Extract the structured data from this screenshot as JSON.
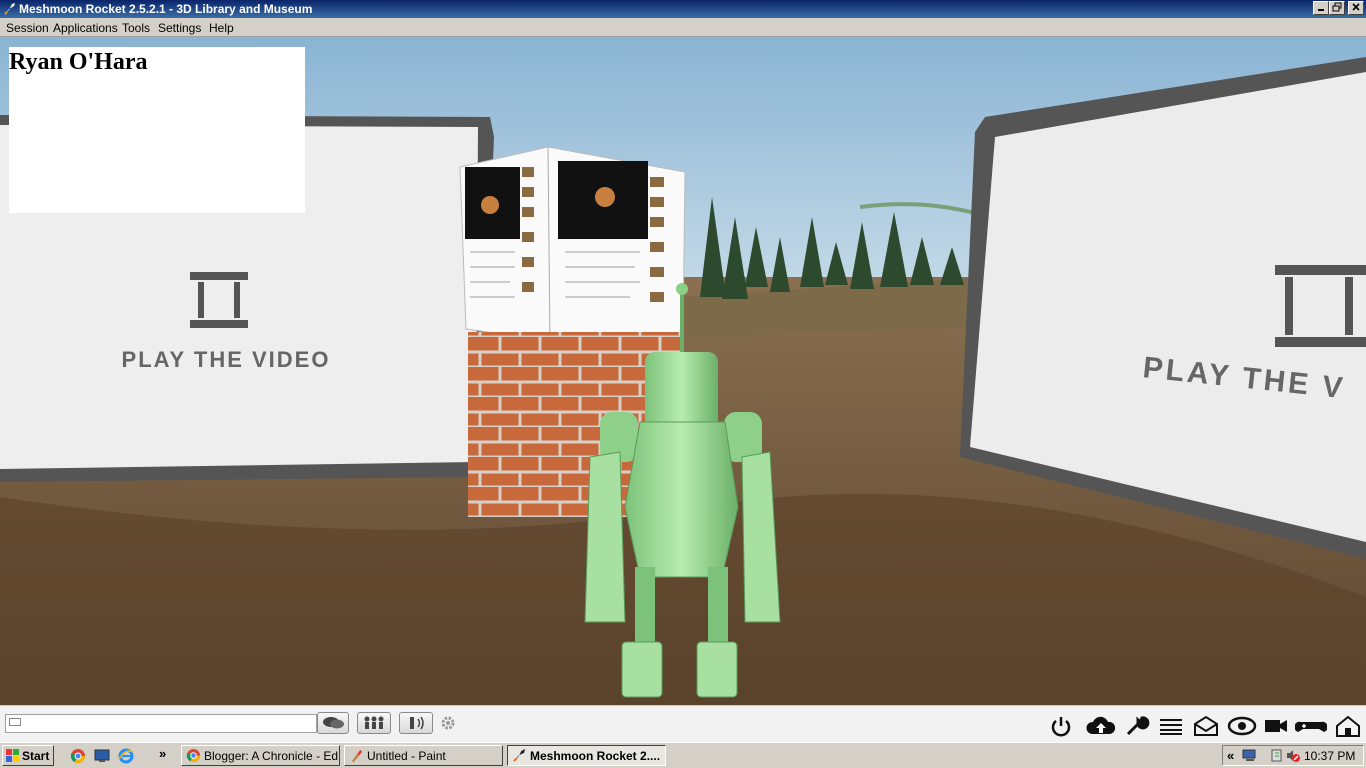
{
  "window": {
    "title": "Meshmoon Rocket 2.5.2.1 - 3D Library and Museum"
  },
  "menu": [
    "Session",
    "Applications",
    "Tools",
    "Settings",
    "Help"
  ],
  "viewport": {
    "overlay_name": "Ryan O'Hara",
    "left_screen_text": "PLAY THE VIDEO",
    "right_screen_text": "PLAY THE V"
  },
  "toolbar": {
    "chat_value": "",
    "chat_placeholder": "",
    "left_buttons": [
      "chat-bubbles-icon",
      "users-icon",
      "voice-icon",
      "settings-gear-icon"
    ],
    "right_icons": [
      "power-icon",
      "cloud-upload-icon",
      "wrench-icon",
      "layers-icon",
      "mail-icon",
      "eye-icon",
      "camera-icon",
      "gamepad-icon",
      "home-icon"
    ]
  },
  "taskbar": {
    "start_label": "Start",
    "quick_launch": [
      "chrome-icon",
      "desktop-icon",
      "ie-icon"
    ],
    "more_glyph": "»",
    "tasks": [
      {
        "label": "Blogger: A Chronicle - Ed...",
        "icon": "chrome-icon",
        "active": false
      },
      {
        "label": "Untitled - Paint",
        "icon": "paint-icon",
        "active": false
      },
      {
        "label": "Meshmoon Rocket 2....",
        "icon": "rocket-icon",
        "active": true
      }
    ],
    "tray_expand": "«",
    "clock": "10:37 PM"
  },
  "colors": {
    "titlebar": "#0a246a",
    "chrome": "#d4d0c8",
    "sky": "#a8c8e0",
    "ground": "#6e5436",
    "robot": "#9fd89b",
    "brick": "#c86a3e"
  }
}
